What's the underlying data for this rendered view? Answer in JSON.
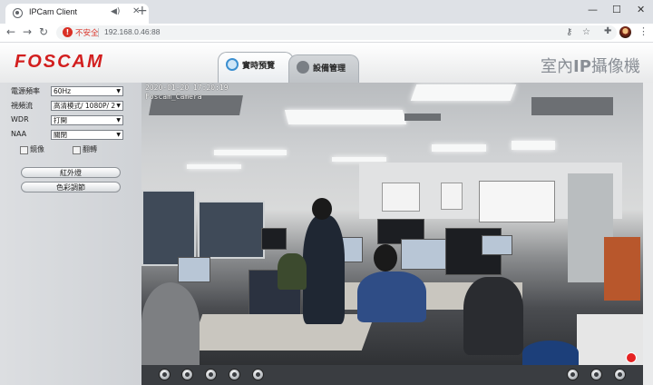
{
  "browser": {
    "tab_title": "IPCam Client",
    "warning_text": "不安全",
    "url": "192.168.0.46:88"
  },
  "header": {
    "logo": "FOSCAM",
    "title_prefix": "室內",
    "title_ip": "IP",
    "title_suffix": "攝像機",
    "tabs": [
      {
        "label": "實時預覽",
        "active": true
      },
      {
        "label": "設備管理",
        "active": false
      }
    ]
  },
  "panel": {
    "rows": [
      {
        "label": "電源頻率",
        "value": "60Hz"
      },
      {
        "label": "視頻流",
        "value": "高清模式/ 1080P/ 2"
      },
      {
        "label": "WDR",
        "value": "打開"
      },
      {
        "label": "NAA",
        "value": "關閉"
      }
    ],
    "checks": [
      {
        "label": "鏡像"
      },
      {
        "label": "翻轉"
      }
    ],
    "buttons": [
      {
        "label": "紅外燈"
      },
      {
        "label": "色彩調節"
      }
    ]
  },
  "video": {
    "timestamp": "2020-01-20 17:20:19",
    "camera_name": "Foscam_Camera"
  }
}
